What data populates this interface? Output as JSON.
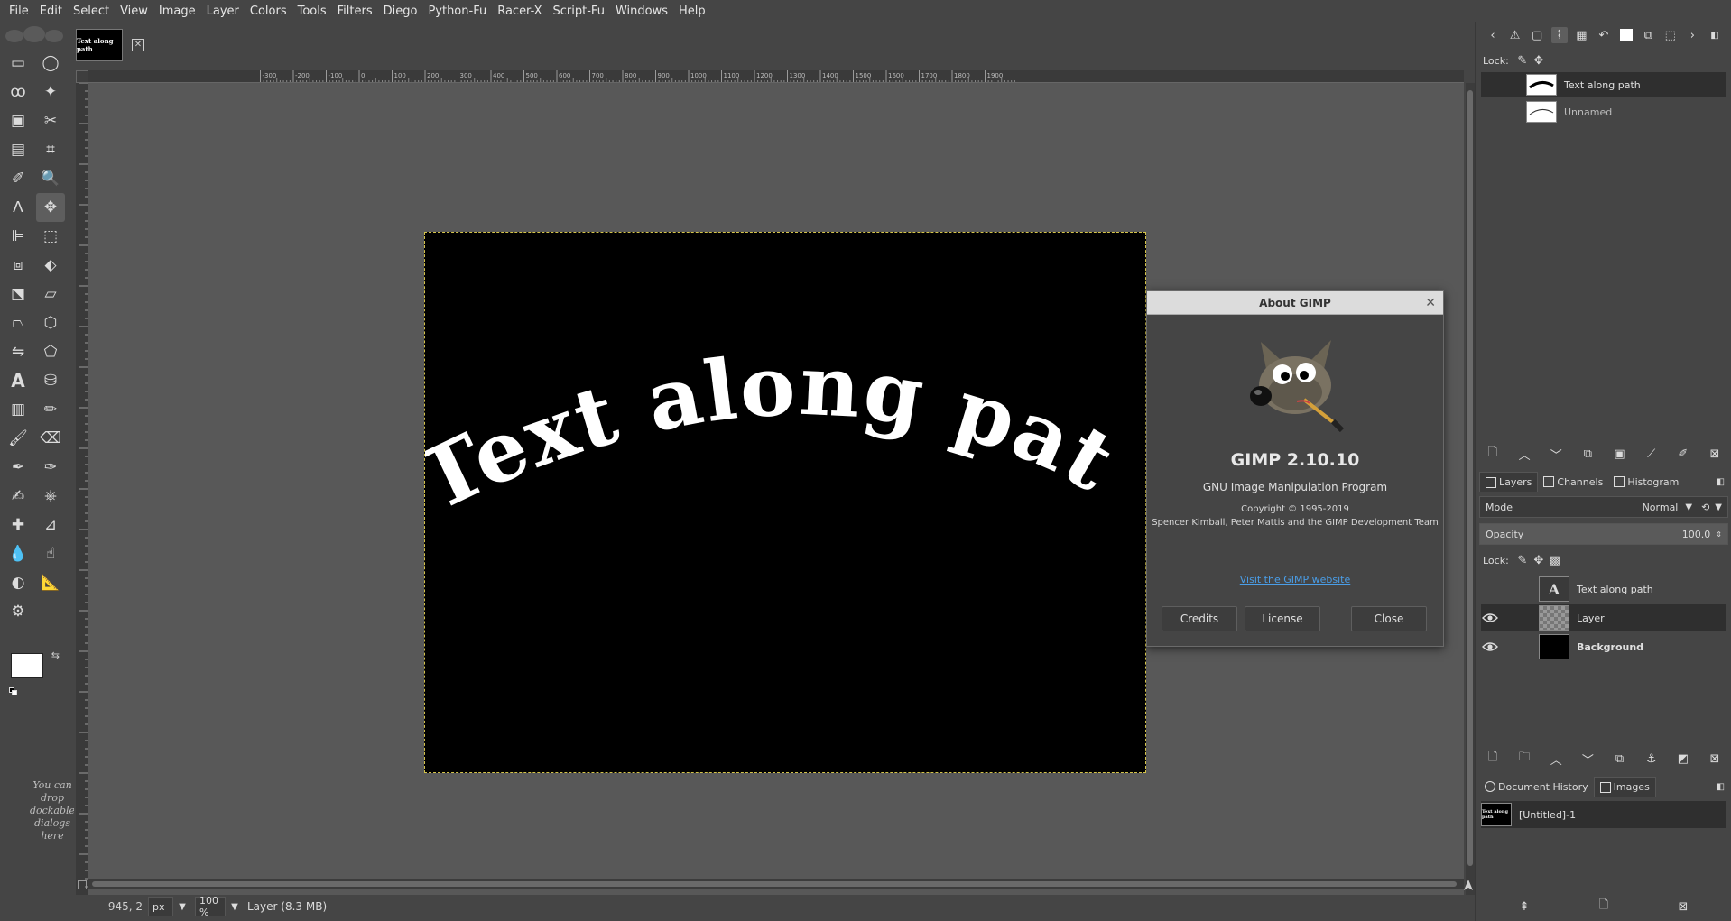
{
  "menubar": {
    "items": [
      "File",
      "Edit",
      "Select",
      "View",
      "Image",
      "Layer",
      "Colors",
      "Tools",
      "Filters",
      "Diego",
      "Python-Fu",
      "Racer-X",
      "Script-Fu",
      "Windows",
      "Help"
    ]
  },
  "toolbox": {
    "tools": [
      "rect-select-icon",
      "ellipse-select-icon",
      "free-select-icon",
      "fuzzy-select-icon",
      "by-color-select-icon",
      "scissors-select-icon",
      "foreground-select-icon",
      "crop-icon",
      "color-picker-icon",
      "zoom-icon",
      "paths-icon",
      "move-icon",
      "align-icon",
      "transform-icon",
      "unified-transform-icon",
      "warp-transform-icon",
      "handle-transform-icon",
      "shear-icon",
      "perspective-icon",
      "3d-transform-icon",
      "flip-icon",
      "cage-transform-icon",
      "text-icon",
      "bucket-fill-icon",
      "gradient-icon",
      "pencil-icon",
      "paintbrush-icon",
      "eraser-icon",
      "airbrush-icon",
      "ink-icon",
      "mypaint-brush-icon",
      "clone-icon",
      "heal-icon",
      "perspective-clone-icon",
      "blur-icon",
      "smudge-icon",
      "dodge-burn-icon",
      "measure-icon",
      "gegl-icon"
    ],
    "active_tool": "move-icon",
    "foreground_color": "#ffffff",
    "background_color": "#000000",
    "drop_hint": "You can drop dockable dialogs here"
  },
  "image_window": {
    "tab_thumbnail_text": "Text along path",
    "canvas_text": "Text along path",
    "ruler_labels": [
      "-300",
      "-200",
      "-100",
      "0",
      "100",
      "200",
      "300",
      "400",
      "500",
      "600",
      "700",
      "800",
      "900",
      "1000",
      "1100",
      "1200",
      "1300",
      "1400",
      "1500",
      "1600",
      "1700",
      "1800",
      "1900"
    ],
    "selection_color": "#d4c34a"
  },
  "statusbar": {
    "coords": "945, 2",
    "unit": "px",
    "zoom": "100 %",
    "message": "Layer (8.3 MB)"
  },
  "dock": {
    "paths": [
      {
        "label": "Text along path",
        "selected": true
      },
      {
        "label": "Unnamed",
        "selected": false
      }
    ],
    "lock_label": "Lock:",
    "layers_tabs": [
      "Layers",
      "Channels",
      "Histogram"
    ],
    "mode_label": "Mode",
    "mode_value": "Normal",
    "opacity_label": "Opacity",
    "opacity_value": "100.0",
    "layers": [
      {
        "label": "Text along path",
        "visible": false,
        "bold": false
      },
      {
        "label": "Layer",
        "visible": true,
        "bold": false
      },
      {
        "label": "Background",
        "visible": true,
        "bold": true
      }
    ],
    "bottom_tabs": [
      "Document History",
      "Images"
    ],
    "images": [
      {
        "label": "[Untitled]-1"
      }
    ]
  },
  "about_dialog": {
    "title": "About GIMP",
    "version": "GIMP 2.10.10",
    "program": "GNU Image Manipulation Program",
    "copyright": "Copyright © 1995-2019",
    "authors": "Spencer Kimball, Peter Mattis and the GIMP Development Team",
    "link": "Visit the GIMP website",
    "buttons": {
      "credits": "Credits",
      "license": "License",
      "close": "Close"
    }
  }
}
